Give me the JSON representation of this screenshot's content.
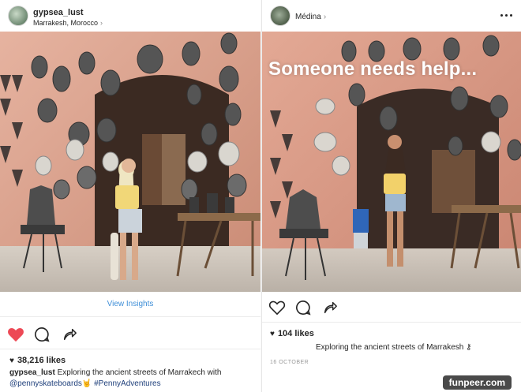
{
  "left_post": {
    "username": "gypsea_lust",
    "location": "Marrakesh, Morocco",
    "view_insights": "View Insights",
    "likes": "38,216 likes",
    "caption_user": "gypsea_lust",
    "caption_text": "Exploring the ancient streets of Marrakech with",
    "caption_line2_mention": "@pennyskateboards",
    "caption_line2_hashtag": "#PennyAdventures",
    "caption_emoji": "🤘"
  },
  "right_post": {
    "location": "Médina",
    "overlay_text": "Someone needs help...",
    "likes": "104 likes",
    "caption_text": "Exploring the ancient streets of Marrakesh",
    "date": "16 OCTOBER"
  },
  "watermark": "funpeer.com",
  "colors": {
    "wall": "#d89c86",
    "floor": "#ccc4bb",
    "heart_red": "#ed4956",
    "link_blue": "#3f8fd8"
  }
}
